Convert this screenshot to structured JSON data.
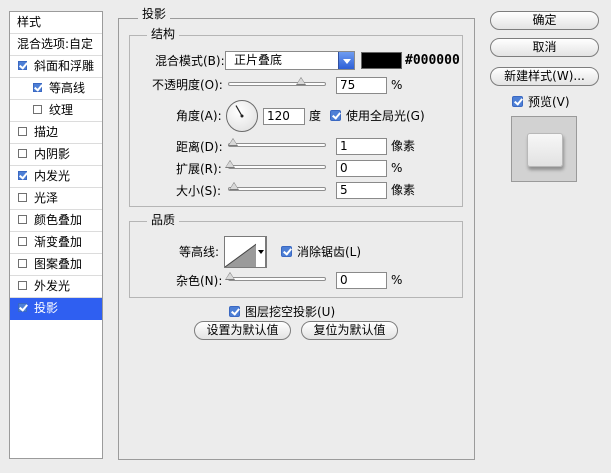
{
  "sidebar": {
    "styles_header": "样式",
    "blend_header": "混合选项:自定",
    "items": [
      {
        "label": "斜面和浮雕",
        "checked": true,
        "indent": false,
        "selected": false
      },
      {
        "label": "等高线",
        "checked": true,
        "indent": true,
        "selected": false
      },
      {
        "label": "纹理",
        "checked": false,
        "indent": true,
        "selected": false
      },
      {
        "label": "描边",
        "checked": false,
        "indent": false,
        "selected": false
      },
      {
        "label": "内阴影",
        "checked": false,
        "indent": false,
        "selected": false
      },
      {
        "label": "内发光",
        "checked": true,
        "indent": false,
        "selected": false
      },
      {
        "label": "光泽",
        "checked": false,
        "indent": false,
        "selected": false
      },
      {
        "label": "颜色叠加",
        "checked": false,
        "indent": false,
        "selected": false
      },
      {
        "label": "渐变叠加",
        "checked": false,
        "indent": false,
        "selected": false
      },
      {
        "label": "图案叠加",
        "checked": false,
        "indent": false,
        "selected": false
      },
      {
        "label": "外发光",
        "checked": false,
        "indent": false,
        "selected": false
      },
      {
        "label": "投影",
        "checked": true,
        "indent": false,
        "selected": true
      }
    ]
  },
  "panel": {
    "title": "投影",
    "structure": {
      "title": "结构",
      "blend_mode_label": "混合模式(B):",
      "blend_mode_value": "正片叠底",
      "color_value": "#000000",
      "opacity_label": "不透明度(O):",
      "opacity_value": "75",
      "opacity_unit": "%",
      "opacity_fraction": 0.75,
      "angle_label": "角度(A):",
      "angle_value": "120",
      "angle_unit": "度",
      "global_light_label": "使用全局光(G)",
      "global_light_checked": true,
      "distance_label": "距离(D):",
      "distance_value": "1",
      "distance_unit": "像素",
      "spread_label": "扩展(R):",
      "spread_value": "0",
      "spread_unit": "%",
      "size_label": "大小(S):",
      "size_value": "5",
      "size_unit": "像素"
    },
    "quality": {
      "title": "品质",
      "contour_label": "等高线:",
      "antialias_label": "消除锯齿(L)",
      "antialias_checked": true,
      "noise_label": "杂色(N):",
      "noise_value": "0",
      "noise_unit": "%"
    },
    "knockout_label": "图层挖空投影(U)",
    "knockout_checked": true,
    "make_default_label": "设置为默认值",
    "reset_default_label": "复位为默认值"
  },
  "buttons": {
    "ok": "确定",
    "cancel": "取消",
    "new_style": "新建样式(W)...",
    "preview_label": "预览(V)",
    "preview_checked": true
  },
  "colors": {
    "selection": "#2f5ff1",
    "shadow_color": "#000000"
  }
}
